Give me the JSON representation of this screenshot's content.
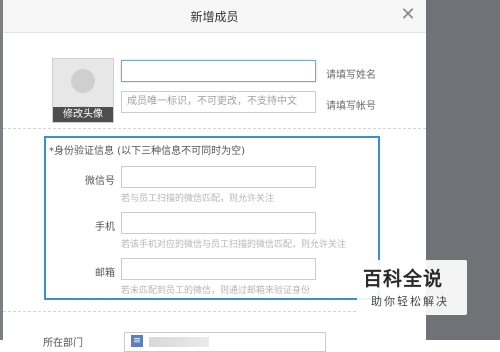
{
  "dialog": {
    "title": "新增成员",
    "close_icon": "close-icon"
  },
  "avatar": {
    "button_label": "修改头像"
  },
  "name_field": {
    "value": "",
    "placeholder": "",
    "hint": "请填写姓名"
  },
  "account_field": {
    "placeholder": "成员唯一标识，不可更改，不支持中文",
    "hint": "请填写帐号"
  },
  "verify": {
    "title": "*身份验证信息 (以下三种信息不可同时为空)",
    "rows": [
      {
        "label": "微信号",
        "placeholder": "",
        "hint": "若与员工扫描的微信匹配，则允许关注"
      },
      {
        "label": "手机",
        "placeholder": "",
        "hint": "若该手机对应的微信与员工扫描的微信匹配，则允许关注"
      },
      {
        "label": "邮箱",
        "placeholder": "",
        "hint": "若未匹配到员工的微信，则通过邮箱来验证身份"
      }
    ]
  },
  "department": {
    "label": "所在部门"
  },
  "watermark": {
    "main": "百科全说",
    "sub": "助你轻松解决"
  },
  "colors": {
    "accent_border": "#3b8ed4",
    "focus_border": "#79a6d6",
    "header_bg": "#f6f6f6"
  }
}
